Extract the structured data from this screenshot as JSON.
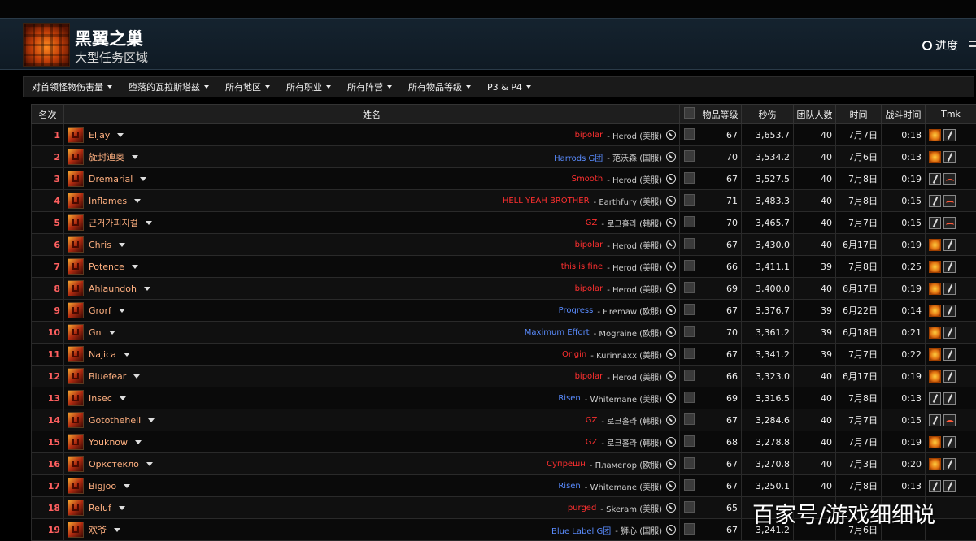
{
  "header": {
    "zone_name": "黑翼之巢",
    "zone_subtitle": "大型任务区域",
    "progress_label": "进度"
  },
  "filters": [
    "对首领怪物伤害量",
    "堕落的瓦拉斯塔兹",
    "所有地区",
    "所有职业",
    "所有阵营",
    "所有物品等级",
    "P3 & P4"
  ],
  "columns": {
    "rank": "名次",
    "name": "姓名",
    "item_level": "物品等级",
    "dps": "秒伤",
    "raid_size": "团队人数",
    "date": "时间",
    "duration": "战斗时间",
    "tmk": "Tmk"
  },
  "rows": [
    {
      "rank": "1",
      "name": "Eljay",
      "guild": "bipolar",
      "guild_color": "red",
      "server": "Herod (美服)",
      "ilvl": "67",
      "dps": "3,653.7",
      "size": "40",
      "date": "7月7日",
      "time": "0:18",
      "tmk": [
        "gold",
        "sword"
      ]
    },
    {
      "rank": "2",
      "name": "旋封迪奥",
      "guild": "Harrods G团",
      "guild_color": "blue",
      "server": "范沃森 (国服)",
      "ilvl": "70",
      "dps": "3,534.2",
      "size": "40",
      "date": "7月6日",
      "time": "0:13",
      "tmk": [
        "gold",
        "sword"
      ]
    },
    {
      "rank": "3",
      "name": "Dremarial",
      "guild": "Smooth",
      "guild_color": "red",
      "server": "Herod (美服)",
      "ilvl": "67",
      "dps": "3,527.5",
      "size": "40",
      "date": "7月8日",
      "time": "0:19",
      "tmk": [
        "sword",
        "flame"
      ]
    },
    {
      "rank": "4",
      "name": "Inflames",
      "guild": "HELL YEAH BROTHER",
      "guild_color": "red",
      "server": "Earthfury (美服)",
      "ilvl": "71",
      "dps": "3,483.3",
      "size": "40",
      "date": "7月8日",
      "time": "0:15",
      "tmk": [
        "sword",
        "flame"
      ]
    },
    {
      "rank": "5",
      "name": "근거가피지컬",
      "guild": "GZ",
      "guild_color": "red",
      "server": "로크홀라 (韩服)",
      "ilvl": "70",
      "dps": "3,465.7",
      "size": "40",
      "date": "7月7日",
      "time": "0:15",
      "tmk": [
        "sword",
        "flame"
      ]
    },
    {
      "rank": "6",
      "name": "Chris",
      "guild": "bipolar",
      "guild_color": "red",
      "server": "Herod (美服)",
      "ilvl": "67",
      "dps": "3,430.0",
      "size": "40",
      "date": "6月17日",
      "time": "0:19",
      "tmk": [
        "gold",
        "sword"
      ]
    },
    {
      "rank": "7",
      "name": "Potence",
      "guild": "this is fine",
      "guild_color": "red",
      "server": "Herod (美服)",
      "ilvl": "66",
      "dps": "3,411.1",
      "size": "39",
      "date": "7月8日",
      "time": "0:25",
      "tmk": [
        "gold",
        "sword"
      ]
    },
    {
      "rank": "8",
      "name": "Ahlaundoh",
      "guild": "bipolar",
      "guild_color": "red",
      "server": "Herod (美服)",
      "ilvl": "69",
      "dps": "3,400.0",
      "size": "40",
      "date": "6月17日",
      "time": "0:19",
      "tmk": [
        "gold",
        "sword"
      ]
    },
    {
      "rank": "9",
      "name": "Grorf",
      "guild": "Progress",
      "guild_color": "blue",
      "server": "Firemaw (欧服)",
      "ilvl": "67",
      "dps": "3,376.7",
      "size": "39",
      "date": "6月22日",
      "time": "0:14",
      "tmk": [
        "gold",
        "sword"
      ]
    },
    {
      "rank": "10",
      "name": "Gn",
      "guild": "Maximum Effort",
      "guild_color": "blue",
      "server": "Mograine (欧服)",
      "ilvl": "70",
      "dps": "3,361.2",
      "size": "39",
      "date": "6月18日",
      "time": "0:21",
      "tmk": [
        "gold",
        "sword"
      ]
    },
    {
      "rank": "11",
      "name": "Najica",
      "guild": "Origin",
      "guild_color": "red",
      "server": "Kurinnaxx (美服)",
      "ilvl": "67",
      "dps": "3,341.2",
      "size": "39",
      "date": "7月7日",
      "time": "0:22",
      "tmk": [
        "gold",
        "sword"
      ]
    },
    {
      "rank": "12",
      "name": "Bluefear",
      "guild": "bipolar",
      "guild_color": "red",
      "server": "Herod (美服)",
      "ilvl": "66",
      "dps": "3,323.0",
      "size": "40",
      "date": "6月17日",
      "time": "0:19",
      "tmk": [
        "gold",
        "sword"
      ]
    },
    {
      "rank": "13",
      "name": "Insec",
      "guild": "Risen",
      "guild_color": "blue",
      "server": "Whitemane (美服)",
      "ilvl": "69",
      "dps": "3,316.5",
      "size": "40",
      "date": "7月8日",
      "time": "0:13",
      "tmk": [
        "sword",
        "sword"
      ]
    },
    {
      "rank": "14",
      "name": "Gotothehell",
      "guild": "GZ",
      "guild_color": "red",
      "server": "로크홀라 (韩服)",
      "ilvl": "67",
      "dps": "3,284.6",
      "size": "40",
      "date": "7月7日",
      "time": "0:15",
      "tmk": [
        "sword",
        "flame"
      ]
    },
    {
      "rank": "15",
      "name": "Youknow",
      "guild": "GZ",
      "guild_color": "red",
      "server": "로크홀라 (韩服)",
      "ilvl": "68",
      "dps": "3,278.8",
      "size": "40",
      "date": "7月7日",
      "time": "0:19",
      "tmk": [
        "gold",
        "sword"
      ]
    },
    {
      "rank": "16",
      "name": "Оркстекло",
      "guild": "Супрешн",
      "guild_color": "red",
      "server": "Пламегор (欧服)",
      "ilvl": "67",
      "dps": "3,270.8",
      "size": "40",
      "date": "7月3日",
      "time": "0:20",
      "tmk": [
        "gold",
        "sword"
      ]
    },
    {
      "rank": "17",
      "name": "Bigjoo",
      "guild": "Risen",
      "guild_color": "blue",
      "server": "Whitemane (美服)",
      "ilvl": "67",
      "dps": "3,250.1",
      "size": "40",
      "date": "7月8日",
      "time": "0:13",
      "tmk": [
        "sword",
        "sword"
      ]
    },
    {
      "rank": "18",
      "name": "Reluf",
      "guild": "purged",
      "guild_color": "red",
      "server": "Skeram (美服)",
      "ilvl": "65",
      "dps": "",
      "size": "",
      "date": "",
      "time": "",
      "tmk": []
    },
    {
      "rank": "19",
      "name": "欢爷",
      "guild": "Blue Label G团",
      "guild_color": "blue",
      "server": "狮心 (国服)",
      "ilvl": "67",
      "dps": "3,241.2",
      "size": "",
      "date": "7月6日",
      "time": "",
      "tmk": []
    }
  ],
  "watermark": "百家号/游戏细细说"
}
